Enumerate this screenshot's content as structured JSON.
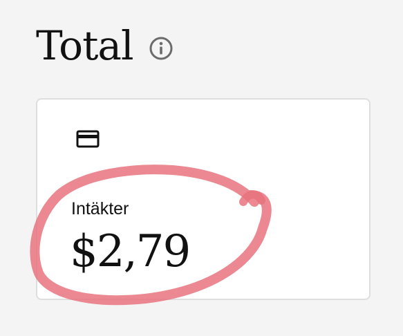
{
  "header": {
    "title": "Total",
    "info_icon": "info-icon"
  },
  "card": {
    "icon": "credit-card-icon",
    "label": "Intäkter",
    "amount": "$2,79"
  },
  "colors": {
    "background": "#f4f4f4",
    "card_background": "#ffffff",
    "annotation": "#e8737e"
  }
}
